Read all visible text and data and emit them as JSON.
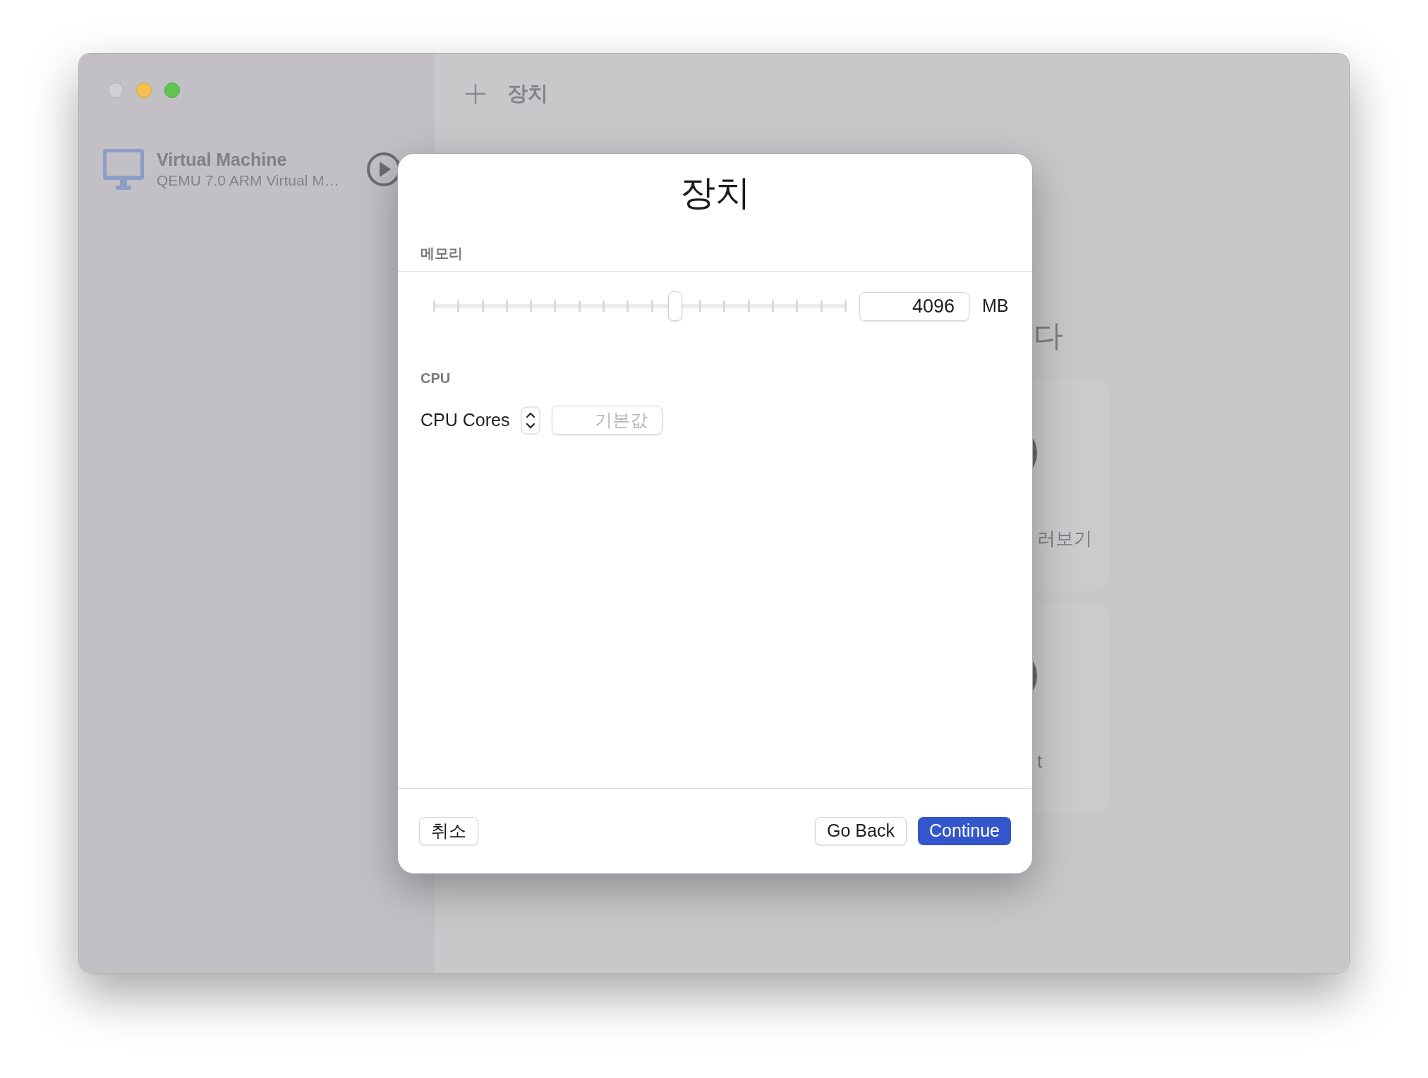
{
  "sidebar": {
    "items": [
      {
        "title": "Virtual Machine",
        "subtitle": "QEMU 7.0 ARM Virtual M…"
      }
    ]
  },
  "toolbar": {
    "title": "장치"
  },
  "background": {
    "heading": "다",
    "cards": [
      {
        "label": "러보기"
      },
      {
        "label": "t"
      }
    ]
  },
  "sheet": {
    "title": "장치",
    "sections": [
      {
        "kind": "slider",
        "heading": "메모리",
        "level": 0.585,
        "value": "4096",
        "unit": "MB"
      },
      {
        "kind": "stepper",
        "heading": "CPU",
        "label": "CPU Cores",
        "placeholder": "기본값"
      }
    ],
    "buttons": [
      {
        "kind": "plain",
        "label": "취소"
      },
      {
        "kind": "plain",
        "label": "Go Back"
      },
      {
        "kind": "primary",
        "label": "Continue"
      }
    ]
  }
}
